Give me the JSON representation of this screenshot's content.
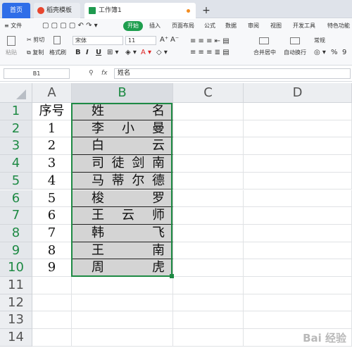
{
  "tabs": [
    {
      "label": "首页"
    },
    {
      "label": "稻壳模板"
    },
    {
      "label": "工作簿1"
    }
  ],
  "new_tab": "+",
  "menu": {
    "file": "≡ 文件",
    "start": "开始",
    "items": [
      "插入",
      "页面布局",
      "公式",
      "数据",
      "审阅",
      "视图",
      "开发工具",
      "特色功能"
    ]
  },
  "ribbon": {
    "paste": "粘贴",
    "cut": "剪切",
    "copy": "复制",
    "format_painter": "格式刷",
    "font": "宋体",
    "font_size": "11",
    "grow": "A⁺",
    "shrink": "A⁻",
    "bold": "B",
    "italic": "I",
    "underline": "U",
    "merge": "合并居中",
    "wrap": "自动换行",
    "numfmt": "常规",
    "percent": "%",
    "comma": "9"
  },
  "formula_bar": {
    "cell_ref": "B1",
    "fx": "fx",
    "content": "姓名"
  },
  "columns": [
    "A",
    "B",
    "C",
    "D"
  ],
  "rows": [
    "1",
    "2",
    "3",
    "4",
    "5",
    "6",
    "7",
    "8",
    "9",
    "10",
    "11",
    "12",
    "13",
    "14"
  ],
  "table": {
    "header": {
      "no": "序号",
      "name": [
        "姓",
        "名"
      ]
    },
    "rows": [
      {
        "no": "1",
        "name": [
          "李",
          "小",
          "曼"
        ]
      },
      {
        "no": "2",
        "name": [
          "白",
          "云"
        ]
      },
      {
        "no": "3",
        "name": [
          "司",
          "徒",
          "剑",
          "南"
        ]
      },
      {
        "no": "4",
        "name": [
          "马",
          "蒂",
          "尔",
          "德"
        ]
      },
      {
        "no": "5",
        "name": [
          "梭",
          "罗"
        ]
      },
      {
        "no": "6",
        "name": [
          "王",
          "云",
          "师"
        ]
      },
      {
        "no": "7",
        "name": [
          "韩",
          "飞"
        ]
      },
      {
        "no": "8",
        "name": [
          "王",
          "南"
        ]
      },
      {
        "no": "9",
        "name": [
          "周",
          "虎"
        ]
      }
    ]
  },
  "watermark": "Bai 经验",
  "colors": {
    "accent": "#1e8a44",
    "tab_active": "#2f6ee8"
  }
}
